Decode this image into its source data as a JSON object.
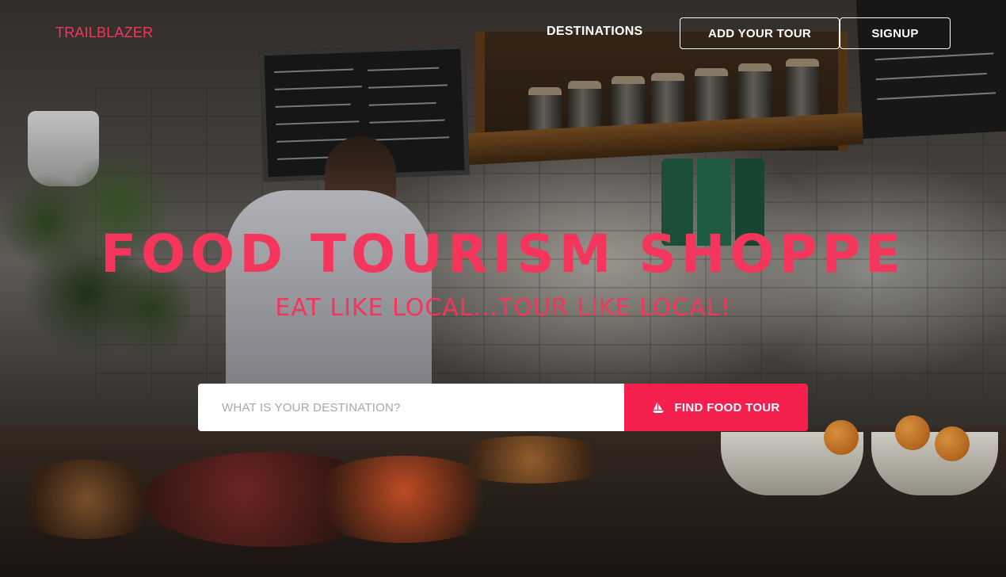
{
  "navbar": {
    "brand": "TRAILBLAZER",
    "destinations_label": "DESTINATIONS",
    "add_tour_label": "ADD YOUR TOUR",
    "signup_label": "SIGNUP"
  },
  "hero": {
    "title": "FOOD TOURISM SHOPPE",
    "subtitle": "EAT LIKE LOCAL...TOUR LIKE LOCAL!"
  },
  "search": {
    "placeholder": "WHAT IS YOUR DESTINATION?",
    "value": "",
    "button_label": "FIND FOOD TOUR",
    "button_icon": "sailboat-icon"
  },
  "colors": {
    "accent": "#f4365c",
    "button": "#f51f4d",
    "nav_text": "#ffffff"
  }
}
